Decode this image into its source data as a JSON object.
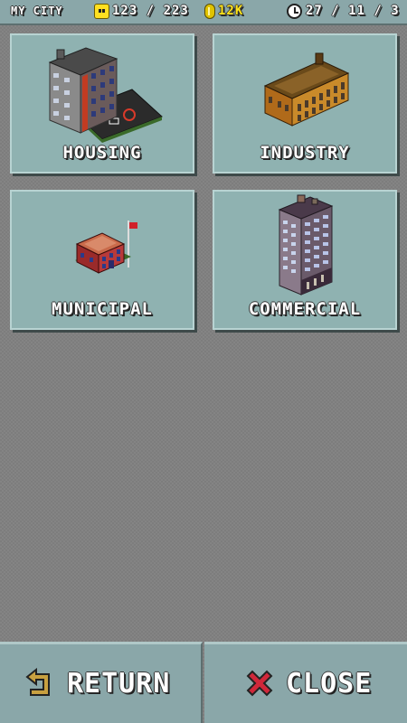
{
  "status_bar": {
    "city_name": "MY CITY",
    "population": "123 / 223",
    "money": "12K",
    "date": "27 / 11 / 3",
    "colors": {
      "money": "#ffe41a",
      "population_icon": "#ffe020",
      "coin_icon": "#e0c300"
    },
    "icons": [
      "population-face-icon",
      "coin-icon",
      "clock-icon"
    ]
  },
  "categories": [
    {
      "label": "HOUSING",
      "icon": "apartment-building-icon"
    },
    {
      "label": "INDUSTRY",
      "icon": "factory-building-icon"
    },
    {
      "label": "MUNICIPAL",
      "icon": "town-hall-icon"
    },
    {
      "label": "COMMERCIAL",
      "icon": "office-tower-icon"
    }
  ],
  "footer": {
    "return_label": "RETURN",
    "close_label": "CLOSE",
    "return_icon": "return-arrow-icon",
    "close_icon": "close-x-icon"
  },
  "colors": {
    "background": "#848484",
    "panel": "#8fb2b1",
    "bar": "#8aa7a9"
  }
}
